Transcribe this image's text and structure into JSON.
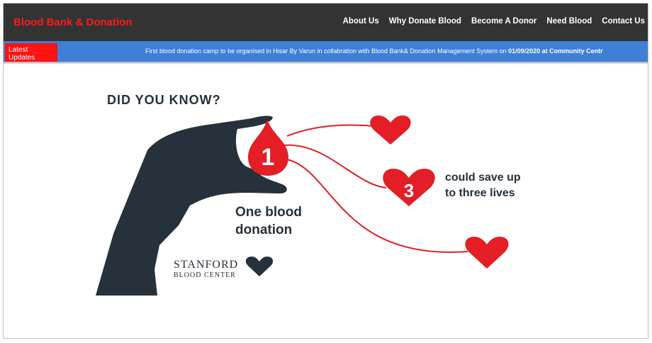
{
  "header": {
    "brand": "Blood Bank & Donation",
    "nav": [
      "About Us",
      "Why Donate Blood",
      "Become A Donor",
      "Need Blood",
      "Contact Us"
    ]
  },
  "ticker": {
    "label_line1": "Latest",
    "label_line2": "Updates",
    "message": "First blood donation camp to be organised in Hisar By Varun in collabration with Blood Bank& Donation Management System on ",
    "message_bold": "01/09/2020 at Community Centr"
  },
  "infographic": {
    "heading": "DID YOU KNOW?",
    "drop_number": "1",
    "heart_number": "3",
    "caption_left_line1": "One blood",
    "caption_left_line2": "donation",
    "caption_right_line1": "could save up",
    "caption_right_line2": "to three lives",
    "logo_line1": "STANFORD",
    "logo_line2": "BLOOD CENTER"
  },
  "colors": {
    "brand_red": "#ff1a1a",
    "navbar": "#333333",
    "ticker_blue": "#3f7fd6",
    "blood_red": "#e31e26",
    "ink": "#27313b"
  }
}
